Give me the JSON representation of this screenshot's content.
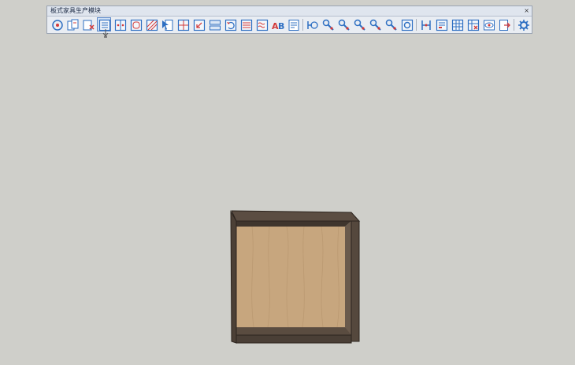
{
  "toolbar": {
    "title": "板式家具生产模块",
    "close_label": "×",
    "tools": [
      {
        "id": "t01",
        "icon": "magnifier-target-icon"
      },
      {
        "id": "t02",
        "icon": "copy-panels-icon"
      },
      {
        "id": "t03",
        "icon": "panel-red-x-icon"
      },
      {
        "id": "t04",
        "icon": "list-lines-icon"
      },
      {
        "id": "t05",
        "icon": "split-panel-icon"
      },
      {
        "id": "t06",
        "icon": "rounded-square-icon"
      },
      {
        "id": "t07",
        "icon": "hatch-pattern-icon"
      },
      {
        "id": "t08",
        "icon": "cursor-panel-icon"
      },
      {
        "id": "t09",
        "icon": "grid-red-icon"
      },
      {
        "id": "t10",
        "icon": "arrow-panel-icon"
      },
      {
        "id": "t11",
        "icon": "two-rows-icon"
      },
      {
        "id": "t12",
        "icon": "refresh-panel-icon"
      },
      {
        "id": "t13",
        "icon": "red-lines-icon"
      },
      {
        "id": "t14",
        "icon": "wave-lines-icon"
      },
      {
        "id": "t15",
        "icon": "ab-text-icon",
        "text": "AB"
      },
      {
        "id": "t16",
        "icon": "document-lines-icon"
      },
      {
        "id": "t17",
        "icon": "hardware-connector-icon"
      },
      {
        "id": "t18",
        "icon": "wrench-tool-icon"
      },
      {
        "id": "t19",
        "icon": "wrench-tool-icon"
      },
      {
        "id": "t20",
        "icon": "wrench-tool-icon"
      },
      {
        "id": "t21",
        "icon": "wrench-tool-icon"
      },
      {
        "id": "t22",
        "icon": "wrench-tool-icon"
      },
      {
        "id": "t23",
        "icon": "gear-frame-icon"
      },
      {
        "id": "t24",
        "icon": "bracket-connector-icon"
      },
      {
        "id": "t25",
        "icon": "form-list-icon"
      },
      {
        "id": "t26",
        "icon": "table-grid-icon"
      },
      {
        "id": "t27",
        "icon": "table-red-icon"
      },
      {
        "id": "t28",
        "icon": "eye-view-icon"
      },
      {
        "id": "t29",
        "icon": "panel-export-icon"
      },
      {
        "id": "t30",
        "icon": "settings-gear-icon"
      }
    ]
  },
  "colors": {
    "canvas_bg": "#cfcfca",
    "icon_blue": "#2e6fc2",
    "icon_red": "#d23a3a",
    "cabinet_frame": "#4a3f36",
    "cabinet_wood": "#c7a67e"
  }
}
